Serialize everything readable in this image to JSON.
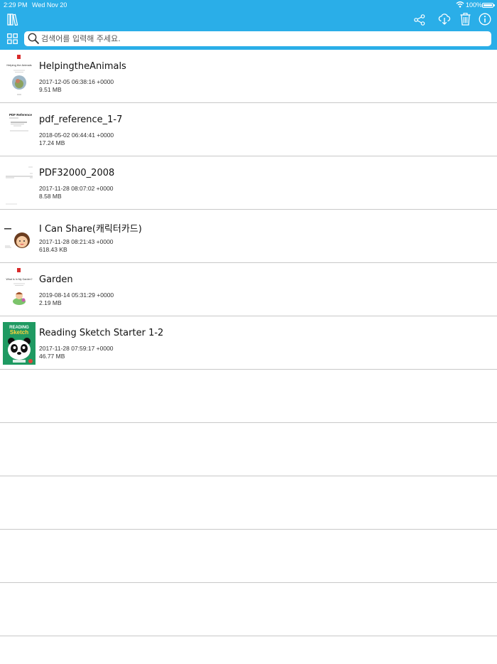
{
  "status_bar": {
    "time": "2:29 PM",
    "date": "Wed Nov 20",
    "battery": "100%"
  },
  "toolbar": {
    "library_icon": "books-icon",
    "share_icon": "share-icon",
    "download_icon": "cloud-download-icon",
    "delete_icon": "trash-icon",
    "info_icon": "info-icon",
    "grid_icon": "grid-view-icon",
    "accent_color": "#2aaee8"
  },
  "search": {
    "placeholder": "검색어를 입력해 주세요.",
    "value": ""
  },
  "files": [
    {
      "name": "HelpingtheAnimals",
      "date": "2017-12-05 06:38:16 +0000",
      "size": "9.51 MB",
      "thumb_title": "Helping the Animals"
    },
    {
      "name": "pdf_reference_1-7",
      "date": "2018-05-02 06:44:41 +0000",
      "size": "17.24 MB",
      "thumb_title": "PDF Reference"
    },
    {
      "name": "PDF32000_2008",
      "date": "2017-11-28 08:07:02 +0000",
      "size": "8.58 MB"
    },
    {
      "name": "I Can Share(캐릭터카드)",
      "date": "2017-11-28 08:21:43 +0000",
      "size": "618.43 KB"
    },
    {
      "name": "Garden",
      "date": "2019-08-14 05:31:29 +0000",
      "size": "2.19 MB",
      "thumb_title": "What Is In My Garden?"
    },
    {
      "name": "Reading Sketch Starter 1-2",
      "date": "2017-11-28 07:59:17 +0000",
      "size": "46.77 MB",
      "thumb_title_1": "READING",
      "thumb_title_2": "Sketch"
    }
  ]
}
